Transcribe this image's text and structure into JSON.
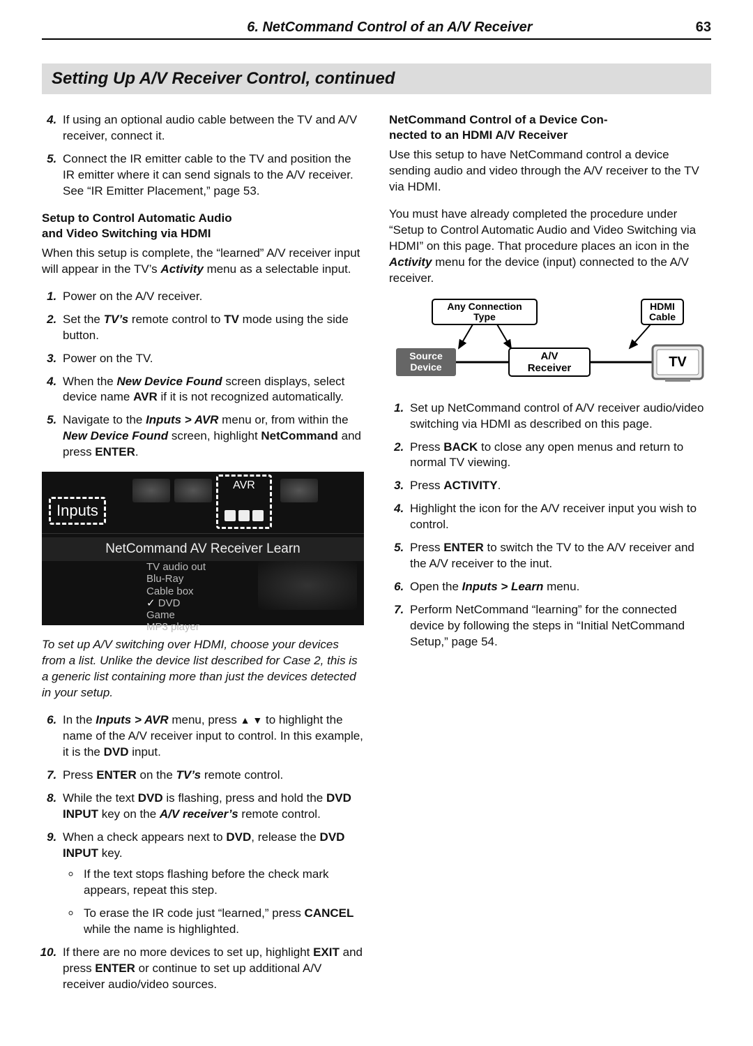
{
  "header": {
    "chapter": "6.  NetCommand Control of an A/V Receiver",
    "page": "63"
  },
  "section_title": "Setting Up A/V Receiver Control, continued",
  "left": {
    "top_list": [
      "If using an optional audio cable between the TV and A/V receiver, connect it.",
      "Connect the IR emitter cable to the TV and position the IR emitter where it can send signals to the A/V receiver.  See “IR Emitter Placement,” page 53."
    ],
    "sub1_line1": "Setup to Control Automatic Audio",
    "sub1_line2": "and Video Switching via HDMI",
    "sub1_para_a": "When this setup is complete, the “learned” A/V receiver input will appear in the TV’s ",
    "sub1_para_b": "Activity",
    "sub1_para_c": " menu as a selectable input.",
    "steps1": {
      "s1": "Power on the A/V receiver.",
      "s2_a": "Set the ",
      "s2_b": "TV’s",
      "s2_c": " remote control to ",
      "s2_d": "TV",
      "s2_e": " mode using the side button.",
      "s3": "Power on the TV.",
      "s4_a": "When the ",
      "s4_b": "New Device Found",
      "s4_c": " screen displays, select device name ",
      "s4_d": "AVR",
      "s4_e": " if it is not recognized automatically.",
      "s5_a": "Navigate to the ",
      "s5_b": "Inputs > AVR",
      "s5_c": " menu or, from within the ",
      "s5_d": "New Device Found",
      "s5_e": " screen, highlight ",
      "s5_f": "NetCommand",
      "s5_g": " and press ",
      "s5_h": "ENTER",
      "s5_i": "."
    },
    "figure": {
      "inputs_label": "Inputs",
      "avr_label": "AVR",
      "screen_title": "NetCommand AV Receiver Learn",
      "devices": [
        "TV audio out",
        "Blu-Ray",
        "Cable box",
        "DVD",
        "Game",
        "MP3 player"
      ]
    },
    "caption": "To set up A/V switching over HDMI, choose your devices from a list.  Unlike the device list described for Case 2, this is a generic list containing more than just the devices detected in your setup.",
    "steps2": {
      "s6_a": "In the ",
      "s6_b": "Inputs > AVR",
      "s6_c": " menu, press ",
      "s6_d": "▲ ▼",
      "s6_e": " to highlight the name of the A/V receiver input to control.  In this example, it is the ",
      "s6_f": "DVD",
      "s6_g": " input.",
      "s7_a": "Press ",
      "s7_b": "ENTER",
      "s7_c": " on the ",
      "s7_d": "TV’s",
      "s7_e": " remote control.",
      "s8_a": "While the text ",
      "s8_b": "DVD",
      "s8_c": " is flashing, press and hold the ",
      "s8_d": "DVD INPUT",
      "s8_e": " key on the ",
      "s8_f": "A/V receiver’s",
      "s8_g": " remote control.",
      "s9_a": "When a check appears next to ",
      "s9_b": "DVD",
      "s9_c": ", release the ",
      "s9_d": "DVD INPUT",
      "s9_e": " key.",
      "s9_bul1": "If the text stops flashing before the check mark appears, repeat this step.",
      "s9_bul2_a": "To erase the IR code just “learned,” press ",
      "s9_bul2_b": "CANCEL",
      "s9_bul2_c": " while the name is highlighted.",
      "s10_a": "If there are no more devices to set up, highlight ",
      "s10_b": "EXIT",
      "s10_c": " and press ",
      "s10_d": "ENTER",
      "s10_e": " or continue to set up additional A/V receiver audio/video sources."
    }
  },
  "right": {
    "sub_line1": "NetCommand Control of a Device Con-",
    "sub_line2": "nected to an HDMI A/V Receiver",
    "para1": "Use this setup to have NetCommand control a device sending audio and video through the A/V receiver to the TV via HDMI.",
    "para2_a": "You must have already completed the procedure under “Setup to Control Automatic Audio and Video Switching via HDMI” on this page.  That procedure  places an icon in the ",
    "para2_b": "Activity",
    "para2_c": " menu for the device (input) connected to the A/V receiver.",
    "diagram": {
      "any_line1": "Any Connection",
      "any_line2": "Type",
      "hdmi_line1": "HDMI",
      "hdmi_line2": "Cable",
      "source_line1": "Source",
      "source_line2": "Device",
      "avr_line1": "A/V",
      "avr_line2": "Receiver",
      "tv": "TV"
    },
    "steps": {
      "s1": "Set up NetCommand control of A/V receiver audio/video switching via HDMI as described on this page.",
      "s2_a": "Press ",
      "s2_b": "BACK",
      "s2_c": " to close any open menus and return to normal TV viewing.",
      "s3_a": "Press ",
      "s3_b": "ACTIVITY",
      "s3_c": ".",
      "s4": "Highlight the icon for the A/V receiver input you wish to control.",
      "s5_a": "Press ",
      "s5_b": "ENTER",
      "s5_c": " to switch the TV to the A/V receiver and the A/V receiver to the inut.",
      "s6_a": "Open the ",
      "s6_b": "Inputs > Learn",
      "s6_c": " menu.",
      "s7": "Perform NetCommand “learning” for the connected device by following the steps in “Initial NetCommand Setup,” page 54."
    }
  }
}
